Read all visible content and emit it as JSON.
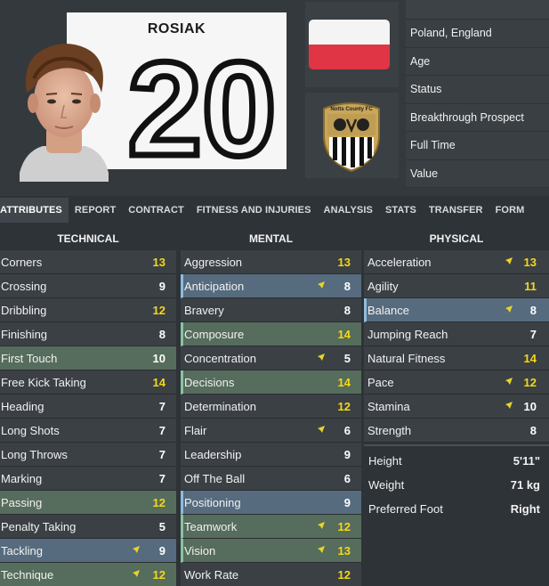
{
  "player": {
    "shirt_name": "ROSIAK",
    "shirt_number": "20"
  },
  "info": {
    "nationality": "Poland, England",
    "age_label": "Age",
    "status_label": "Status",
    "status_value": "Breakthrough Prospect",
    "full_time_label": "Full Time",
    "value_label": "Value"
  },
  "colors": {
    "flag_white": "#f4f4f4",
    "flag_red": "#e03545",
    "highlight_yellow": "#f4d818",
    "row_blue": "#566b7e",
    "row_green": "#566c5c"
  },
  "club": {
    "crest_icon": "notts-county-crest",
    "crest_text": "Notts County FC"
  },
  "tabs": [
    {
      "label": "ATTRIBUTES",
      "active": true
    },
    {
      "label": "REPORT"
    },
    {
      "label": "CONTRACT"
    },
    {
      "label": "FITNESS AND INJURIES"
    },
    {
      "label": "ANALYSIS"
    },
    {
      "label": "STATS"
    },
    {
      "label": "TRANSFER"
    },
    {
      "label": "FORM"
    }
  ],
  "columns": {
    "technical": {
      "title": "TECHNICAL",
      "attributes": [
        {
          "name": "Corners",
          "value": "13",
          "color": "yellow",
          "hl": "",
          "arrow": false
        },
        {
          "name": "Crossing",
          "value": "9",
          "color": "white",
          "hl": "",
          "arrow": false
        },
        {
          "name": "Dribbling",
          "value": "12",
          "color": "yellow",
          "hl": "",
          "arrow": false
        },
        {
          "name": "Finishing",
          "value": "8",
          "color": "white",
          "hl": "",
          "arrow": false
        },
        {
          "name": "First Touch",
          "value": "10",
          "color": "white",
          "hl": "green",
          "arrow": false
        },
        {
          "name": "Free Kick Taking",
          "value": "14",
          "color": "yellow",
          "hl": "",
          "arrow": false
        },
        {
          "name": "Heading",
          "value": "7",
          "color": "white",
          "hl": "",
          "arrow": false
        },
        {
          "name": "Long Shots",
          "value": "7",
          "color": "white",
          "hl": "",
          "arrow": false
        },
        {
          "name": "Long Throws",
          "value": "7",
          "color": "white",
          "hl": "",
          "arrow": false
        },
        {
          "name": "Marking",
          "value": "7",
          "color": "white",
          "hl": "",
          "arrow": false
        },
        {
          "name": "Passing",
          "value": "12",
          "color": "yellow",
          "hl": "green",
          "arrow": false
        },
        {
          "name": "Penalty Taking",
          "value": "5",
          "color": "white",
          "hl": "",
          "arrow": false
        },
        {
          "name": "Tackling",
          "value": "9",
          "color": "white",
          "hl": "blue",
          "arrow": true
        },
        {
          "name": "Technique",
          "value": "12",
          "color": "yellow",
          "hl": "green",
          "arrow": true
        }
      ]
    },
    "mental": {
      "title": "MENTAL",
      "attributes": [
        {
          "name": "Aggression",
          "value": "13",
          "color": "yellow",
          "hl": "",
          "arrow": false
        },
        {
          "name": "Anticipation",
          "value": "8",
          "color": "white",
          "hl": "blue",
          "arrow": true
        },
        {
          "name": "Bravery",
          "value": "8",
          "color": "white",
          "hl": "",
          "arrow": false
        },
        {
          "name": "Composure",
          "value": "14",
          "color": "yellow",
          "hl": "green",
          "arrow": false
        },
        {
          "name": "Concentration",
          "value": "5",
          "color": "white",
          "hl": "",
          "arrow": true
        },
        {
          "name": "Decisions",
          "value": "14",
          "color": "yellow",
          "hl": "green",
          "arrow": false
        },
        {
          "name": "Determination",
          "value": "12",
          "color": "yellow",
          "hl": "",
          "arrow": false
        },
        {
          "name": "Flair",
          "value": "6",
          "color": "white",
          "hl": "",
          "arrow": true
        },
        {
          "name": "Leadership",
          "value": "9",
          "color": "white",
          "hl": "",
          "arrow": false
        },
        {
          "name": "Off The Ball",
          "value": "6",
          "color": "white",
          "hl": "",
          "arrow": false
        },
        {
          "name": "Positioning",
          "value": "9",
          "color": "white",
          "hl": "blue",
          "arrow": false
        },
        {
          "name": "Teamwork",
          "value": "12",
          "color": "yellow",
          "hl": "green",
          "arrow": true
        },
        {
          "name": "Vision",
          "value": "13",
          "color": "yellow",
          "hl": "green",
          "arrow": true
        },
        {
          "name": "Work Rate",
          "value": "12",
          "color": "yellow",
          "hl": "",
          "arrow": false
        }
      ]
    },
    "physical": {
      "title": "PHYSICAL",
      "attributes": [
        {
          "name": "Acceleration",
          "value": "13",
          "color": "yellow",
          "hl": "",
          "arrow": true
        },
        {
          "name": "Agility",
          "value": "11",
          "color": "yellow",
          "hl": "",
          "arrow": false
        },
        {
          "name": "Balance",
          "value": "8",
          "color": "white",
          "hl": "blue",
          "arrow": true
        },
        {
          "name": "Jumping Reach",
          "value": "7",
          "color": "white",
          "hl": "",
          "arrow": false
        },
        {
          "name": "Natural Fitness",
          "value": "14",
          "color": "yellow",
          "hl": "",
          "arrow": false
        },
        {
          "name": "Pace",
          "value": "12",
          "color": "yellow",
          "hl": "",
          "arrow": true
        },
        {
          "name": "Stamina",
          "value": "10",
          "color": "white",
          "hl": "",
          "arrow": true
        },
        {
          "name": "Strength",
          "value": "8",
          "color": "white",
          "hl": "",
          "arrow": false
        }
      ],
      "extras": [
        {
          "label": "Height",
          "value": "5'11\""
        },
        {
          "label": "Weight",
          "value": "71 kg"
        },
        {
          "label": "Preferred Foot",
          "value": "Right"
        }
      ]
    }
  }
}
